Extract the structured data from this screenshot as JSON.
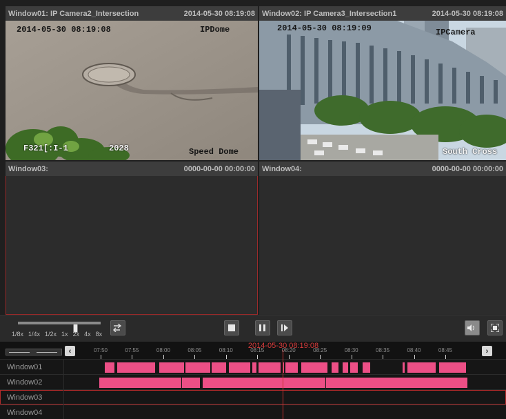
{
  "colors": {
    "recording": "#ec4f86",
    "cursor": "#d63b3b",
    "selected_border": "#9b2b2b"
  },
  "windows": [
    {
      "title": "Window01: IP Camera2_Intersection",
      "time": "2014-05-30 08:19:08",
      "osd_time": "2014-05-30 08:19:08",
      "osd_name": "IPDome",
      "osd_bottom_left": "F321[:I-1",
      "osd_bottom_mid": "2028",
      "osd_bottom_right": "Speed Dome"
    },
    {
      "title": "Window02: IP Camera3_Intersection1",
      "time": "2014-05-30 08:19:08",
      "osd_time": "2014-05-30 08:19:09",
      "osd_name": "IPCamera",
      "osd_bottom_right": "South Cross"
    },
    {
      "title": "Window03:",
      "time": "0000-00-00 00:00:00"
    },
    {
      "title": "Window04:",
      "time": "0000-00-00 00:00:00"
    }
  ],
  "controls": {
    "speeds": [
      "1/8x",
      "1/4x",
      "1/2x",
      "1x",
      "2x",
      "4x",
      "8x"
    ],
    "speed_selected": "1x",
    "icons": {
      "sync": "sync-icon",
      "stop": "stop-icon",
      "pause": "pause-icon",
      "step": "step-forward-icon",
      "audio": "audio-icon",
      "fullscreen": "fullscreen-icon"
    }
  },
  "timeline": {
    "current_time": "2014-05-30 08:19:08",
    "ticks": [
      "07:50",
      "07:55",
      "08:00",
      "08:05",
      "08:10",
      "08:15",
      "08:20",
      "08:25",
      "08:30",
      "08:35",
      "08:40",
      "08:45"
    ],
    "rows": [
      {
        "label": "Window01",
        "segments": [
          [
            "07:50:40",
            "07:52:10"
          ],
          [
            "07:52:40",
            "07:58:40"
          ],
          [
            "07:59:20",
            "08:03:20"
          ],
          [
            "08:03:30",
            "08:07:30"
          ],
          [
            "08:07:40",
            "08:10:00"
          ],
          [
            "08:10:30",
            "08:13:50"
          ],
          [
            "08:14:10",
            "08:14:55"
          ],
          [
            "08:15:10",
            "08:18:40"
          ],
          [
            "08:19:00",
            "08:19:15"
          ],
          [
            "08:19:30",
            "08:21:30"
          ],
          [
            "08:22:00",
            "08:26:10"
          ],
          [
            "08:26:50",
            "08:28:00"
          ],
          [
            "08:28:40",
            "08:29:30"
          ],
          [
            "08:29:50",
            "08:31:00"
          ],
          [
            "08:31:50",
            "08:33:00"
          ],
          [
            "08:38:10",
            "08:38:30"
          ],
          [
            "08:39:00",
            "08:43:30"
          ],
          [
            "08:44:00",
            "08:48:20"
          ]
        ]
      },
      {
        "label": "Window02",
        "segments": [
          [
            "07:49:50",
            "08:02:50"
          ],
          [
            "08:03:00",
            "08:05:50"
          ],
          [
            "08:06:20",
            "08:25:50"
          ],
          [
            "08:26:00",
            "08:48:30"
          ]
        ]
      },
      {
        "label": "Window03",
        "segments": []
      },
      {
        "label": "Window04",
        "segments": []
      }
    ]
  }
}
